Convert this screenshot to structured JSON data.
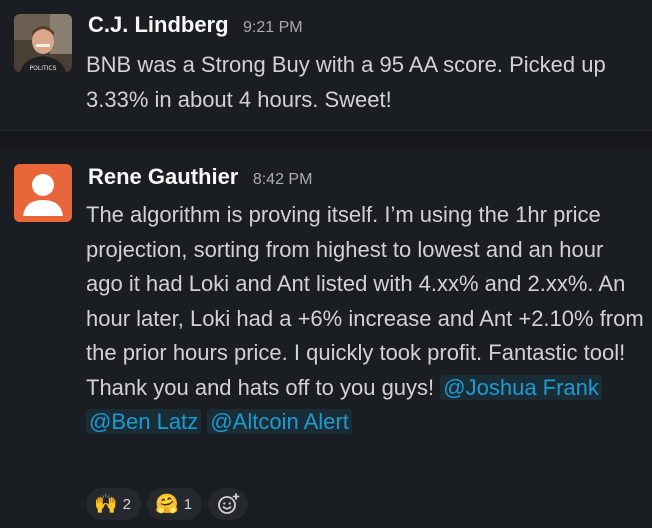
{
  "messages": [
    {
      "author": "C.J. Lindberg",
      "time": "9:21 PM",
      "text": "BNB was a Strong Buy with a 95 AA score. Picked up 3.33% in about 4 hours. Sweet!",
      "avatar_badge": "POLITICS"
    },
    {
      "author": "Rene Gauthier",
      "time": "8:42 PM",
      "text": "The algorithm is proving itself. I’m using the 1hr price projection, sorting from highest to lowest and an hour ago it had Loki and Ant listed with 4.xx% and 2.xx%. An hour later, Loki had a +6% increase and Ant +2.10% from the prior hours price. I quickly took profit. Fantastic tool! Thank you and hats off to you guys!",
      "mentions": [
        "@Joshua Frank",
        "@Ben Latz",
        "@Altcoin Alert"
      ],
      "reactions": [
        {
          "emoji": "🙌",
          "count": "2"
        },
        {
          "emoji": "🤗",
          "count": "1"
        }
      ],
      "avatar_color": "#e8663a"
    }
  ]
}
